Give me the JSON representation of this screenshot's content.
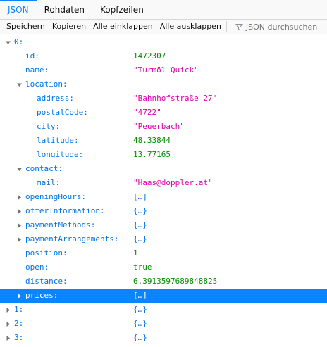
{
  "tabs": [
    {
      "label": "JSON",
      "active": true
    },
    {
      "label": "Rohdaten",
      "active": false
    },
    {
      "label": "Kopfzeilen",
      "active": false
    }
  ],
  "toolbar": {
    "save": "Speichern",
    "copy": "Kopieren",
    "collapse_all": "Alle einklappen",
    "expand_all": "Alle ausklappen",
    "filter_placeholder": "JSON durchsuchen"
  },
  "tree": {
    "root0": "0:",
    "id_key": "id:",
    "id_val": "1472307",
    "name_key": "name:",
    "name_val": "\"Turmöl Quick\"",
    "location_key": "location:",
    "address_key": "address:",
    "address_val": "\"Bahnhofstraße 27\"",
    "postal_key": "postalCode:",
    "postal_val": "\"4722\"",
    "city_key": "city:",
    "city_val": "\"Peuerbach\"",
    "lat_key": "latitude:",
    "lat_val": "48.33844",
    "lon_key": "longitude:",
    "lon_val": "13.77165",
    "contact_key": "contact:",
    "mail_key": "mail:",
    "mail_val": "\"Haas@doppler.at\"",
    "opening_key": "openingHours:",
    "opening_val": "[…]",
    "offer_key": "offerInformation:",
    "offer_val": "{…}",
    "paymethods_key": "paymentMethods:",
    "paymethods_val": "{…}",
    "payarr_key": "paymentArrangements:",
    "payarr_val": "{…}",
    "position_key": "position:",
    "position_val": "1",
    "open_key": "open:",
    "open_val": "true",
    "distance_key": "distance:",
    "distance_val": "6.3913597689848825",
    "prices_key": "prices:",
    "prices_val": "[…]",
    "root1_key": "1:",
    "root1_val": "{…}",
    "root2_key": "2:",
    "root2_val": "{…}",
    "root3_key": "3:",
    "root3_val": "{…}"
  },
  "colors": {
    "accent": "#0a84ff",
    "key": "#0074e8",
    "string": "#dd00a9",
    "number": "#058b00"
  }
}
